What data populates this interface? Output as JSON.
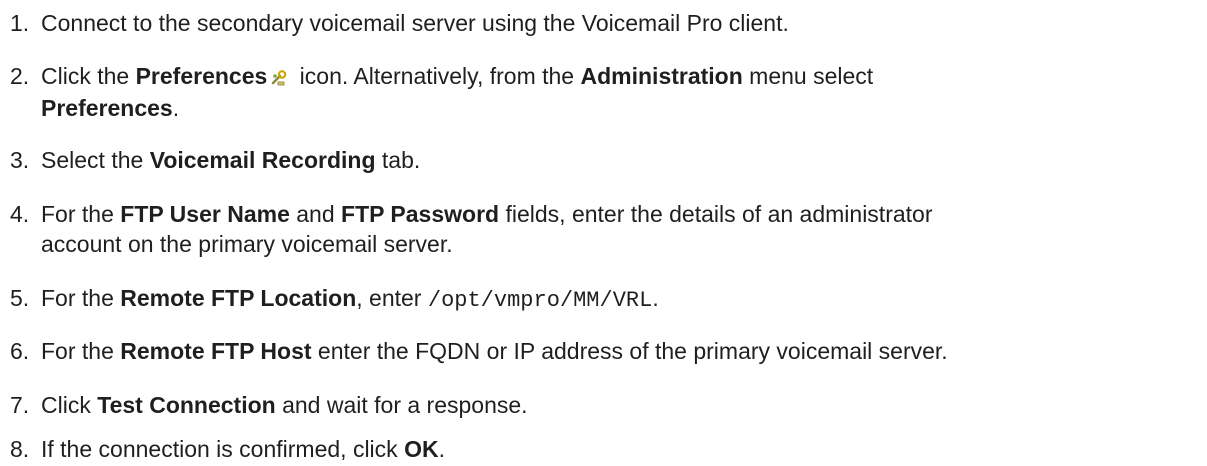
{
  "steps": [
    {
      "number": "1.",
      "text": "Connect to the secondary voicemail server using the Voicemail Pro client."
    },
    {
      "number": "2.",
      "pre": "Click the ",
      "bold1": "Preferences",
      "mid": " icon. Alternatively, from the ",
      "bold2": "Administration",
      "post": " menu select",
      "bold3": "Preferences",
      "end": ".",
      "icon": "preferences-icon"
    },
    {
      "number": "3.",
      "pre": "Select the ",
      "bold1": "Voicemail Recording",
      "post": " tab."
    },
    {
      "number": "4.",
      "pre": "For the ",
      "bold1": "FTP User Name",
      "mid": " and ",
      "bold2": "FTP Password",
      "post": " fields, enter the details of an administrator",
      "line2": "account on the primary voicemail server."
    },
    {
      "number": "5.",
      "pre": "For the ",
      "bold1": "Remote FTP Location",
      "mid": ", enter ",
      "code": "/opt/vmpro/MM/VRL",
      "post": "."
    },
    {
      "number": "6.",
      "pre": "For the ",
      "bold1": "Remote FTP Host",
      "post": " enter the FQDN or IP address of the primary voicemail server."
    },
    {
      "number": "7.",
      "pre": "Click ",
      "bold1": "Test Connection",
      "post": " and wait for a response."
    },
    {
      "number": "8.",
      "pre": "If the connection is confirmed, click ",
      "bold1": "OK",
      "post": "."
    }
  ]
}
